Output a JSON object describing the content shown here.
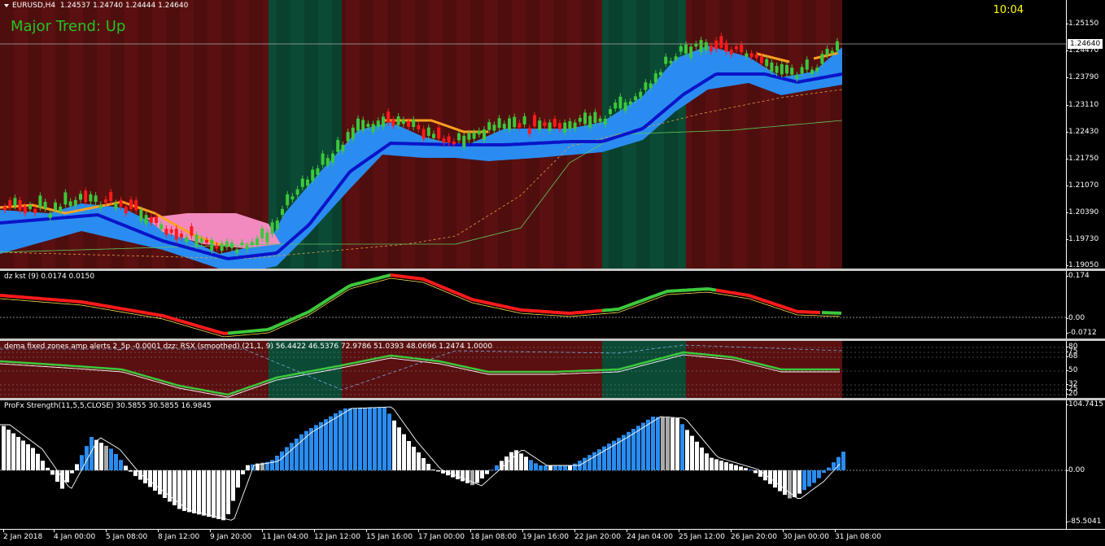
{
  "main": {
    "symbol": "EURUSD,H4",
    "ohlc": "1.24537 1.24740 1.24444 1.24640",
    "trend_text": "Major Trend: Up",
    "clock": "10:04",
    "current_price": "1.24640",
    "price_ticks": [
      "1.25150",
      "1.24470",
      "1.23790",
      "1.23110",
      "1.22430",
      "1.21750",
      "1.21070",
      "1.20390",
      "1.19730",
      "1.19050"
    ]
  },
  "kst": {
    "header": "dz kst (9) 0.0174 0.0150",
    "ticks": [
      "0.174",
      "0.00",
      "-0.0712"
    ]
  },
  "rsx": {
    "header": "dema fixed zones amp alerts 2_5p -0.0001  dzz: RSX (smoothed) (21,1, 9) 56.4422 46.5376 72.9786 51.0393 48.0696 1.2474 1.0000",
    "ticks": [
      "80",
      "75",
      "68",
      "50",
      "32",
      "25",
      "20"
    ]
  },
  "profx": {
    "header": "ProFx Strength(11,5,5,CLOSE) 30.5855 30.5855 16.9845",
    "ticks": [
      "104.7415",
      "0.00",
      "-85.5041"
    ]
  },
  "time_axis": [
    "2 Jan 2018",
    "4 Jan 00:00",
    "5 Jan 08:00",
    "8 Jan 12:00",
    "9 Jan 20:00",
    "11 Jan 04:00",
    "12 Jan 12:00",
    "15 Jan 16:00",
    "17 Jan 00:00",
    "18 Jan 08:00",
    "19 Jan 16:00",
    "22 Jan 20:00",
    "24 Jan 04:00",
    "25 Jan 12:00",
    "26 Jan 20:00",
    "30 Jan 00:00",
    "31 Jan 08:00"
  ],
  "colors": {
    "bear_zone": "#5a1010",
    "bull_zone": "#0b4a35",
    "up_candle": "#3cc83c",
    "down_candle": "#ff1a1a",
    "band": "#2a8cf0",
    "trend_line": "#0a14c8",
    "orange_line": "#ffa020"
  }
}
